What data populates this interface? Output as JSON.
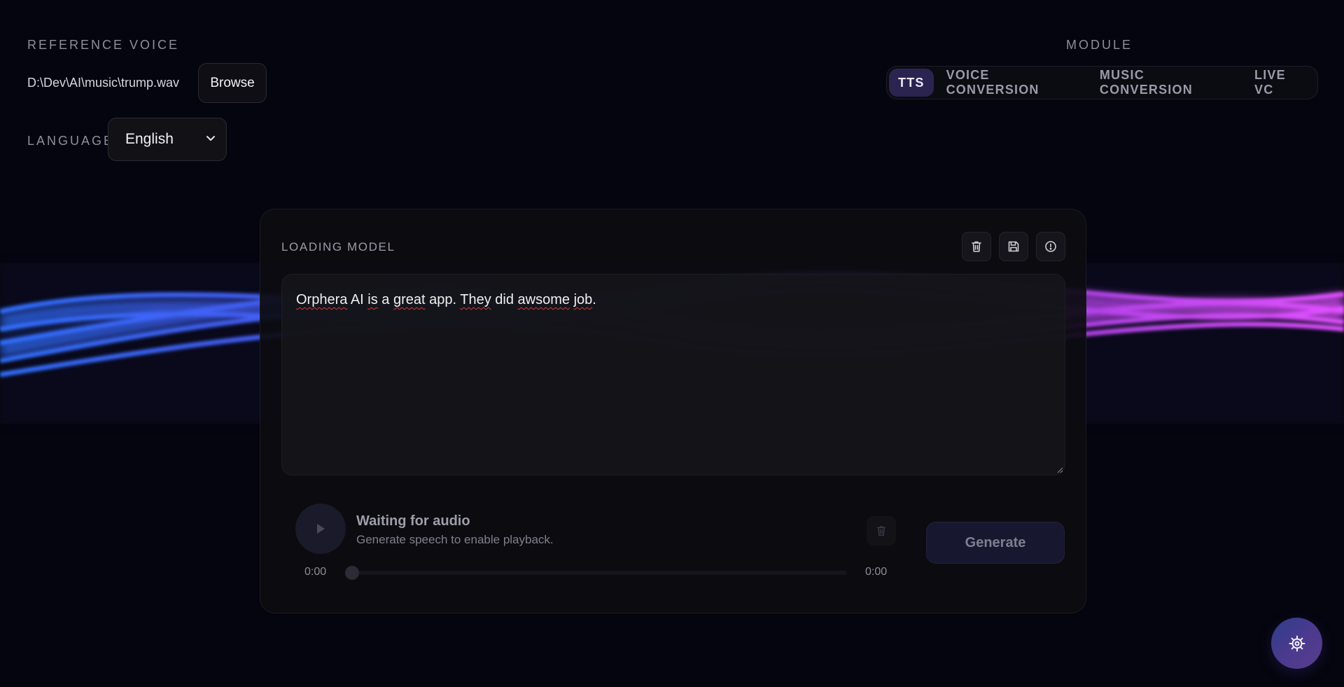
{
  "reference_voice": {
    "label": "REFERENCE VOICE",
    "path": "D:\\Dev\\AI\\music\\trump.wav",
    "browse_label": "Browse"
  },
  "language": {
    "label": "LANGUAGE",
    "selected": "English"
  },
  "module": {
    "label": "MODULE",
    "tabs": [
      {
        "label": "TTS",
        "active": true
      },
      {
        "label": "VOICE CONVERSION",
        "active": false
      },
      {
        "label": "MUSIC CONVERSION",
        "active": false
      },
      {
        "label": "LIVE VC",
        "active": false
      }
    ]
  },
  "card": {
    "status": "LOADING MODEL",
    "icons": [
      "trash-icon",
      "save-icon",
      "info-icon"
    ],
    "text": {
      "value_parts": [
        "",
        "Orphera",
        " AI ",
        "is",
        " a ",
        "great",
        " app. ",
        "They",
        " did ",
        "awsome",
        " ",
        "job",
        "."
      ]
    },
    "player": {
      "title": "Waiting for audio",
      "subtitle": "Generate speech to enable playback.",
      "current_time": "0:00",
      "total_time": "0:00",
      "progress": 0
    },
    "generate_label": "Generate"
  },
  "colors": {
    "background": "#05050f",
    "accent": "#2b2450",
    "wave_left": "#2f7bff",
    "wave_right": "#d94cff"
  },
  "fab_icon": "settings-icon"
}
